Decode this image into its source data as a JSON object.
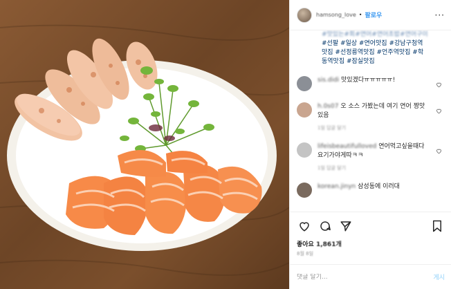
{
  "header": {
    "username": "hamsong_love",
    "separator": "•",
    "follow_label": "팔로우",
    "more_label": "···"
  },
  "caption": {
    "line_faded": "#맛있는#회#연어#연어초밥#연어구이",
    "tags_line1": "#선팔 #일상 #연어맛집 #강남구청역",
    "tags_line2": "맛집 #선정릉역맛집 #언주역맛집 #학",
    "tags_line3": "동역맛집 #잠실맛집"
  },
  "comments": [
    {
      "user": "sis.didi",
      "text": "맛있겠다ㅠㅠㅠㅠㅠ!",
      "meta": "",
      "avatar_color": "#8b8f96"
    },
    {
      "user": "h.0s07",
      "text": "오 소스 가봤는데 여기 연어 짱맛있음",
      "meta": "1일 답글 달기",
      "avatar_color": "#c9a58f"
    },
    {
      "user": "lifeisbeautifulloved",
      "text": "연어먹고싶을때다 요기가야게따ㅋㅋ",
      "meta": "1일 답글 달기",
      "avatar_color": "#c4c4c4"
    },
    {
      "user": "korean.jinyn",
      "text": "삼성동에 이러대",
      "meta": "",
      "avatar_color": "#7a6a5e"
    }
  ],
  "likes": {
    "prefix": "좋아요",
    "count": "1,861개"
  },
  "date": "8월 8일",
  "compose": {
    "placeholder": "댓글 달기...",
    "post_label": "게시"
  },
  "icons": {
    "like": "heart-icon",
    "comment": "comment-icon",
    "share": "share-icon",
    "save": "bookmark-icon"
  }
}
